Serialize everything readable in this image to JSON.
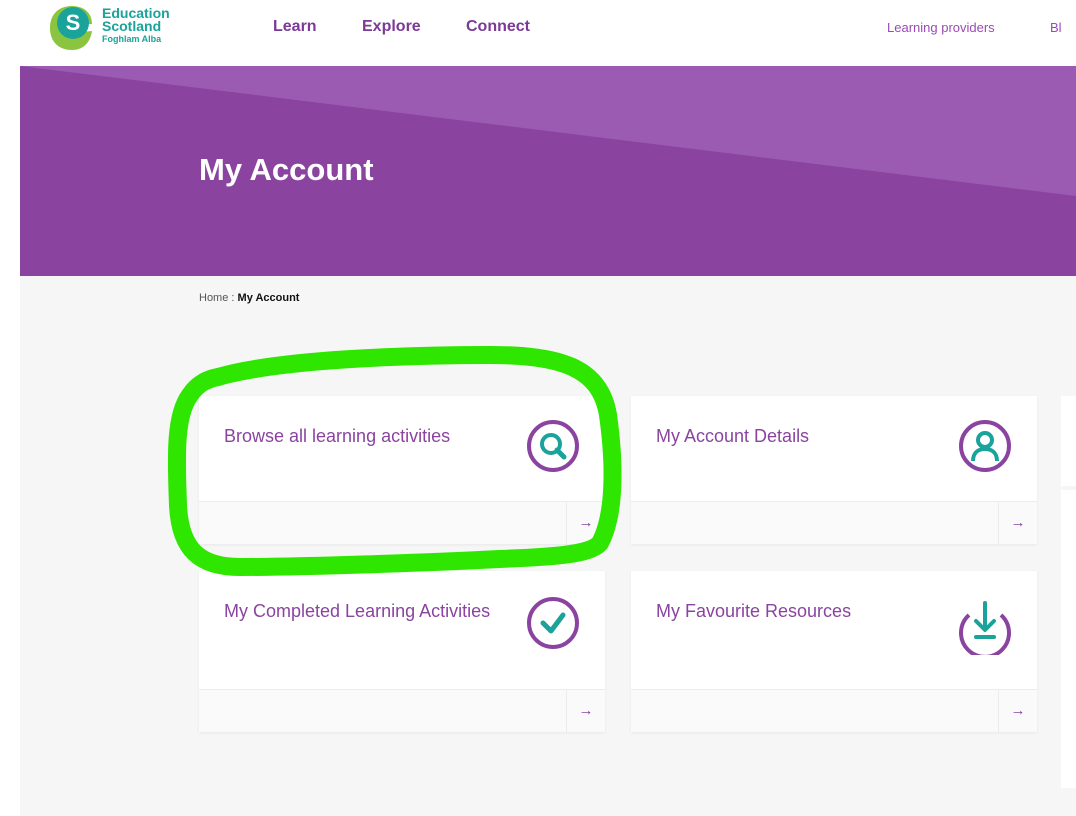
{
  "header": {
    "logo": {
      "line1": "Education",
      "line2": "Scotland",
      "line3": "Foghlam Alba"
    },
    "nav": [
      "Learn",
      "Explore",
      "Connect"
    ],
    "utility": [
      "Learning providers",
      "Bl"
    ]
  },
  "hero": {
    "title": "My Account"
  },
  "breadcrumb": {
    "home": "Home",
    "separator": ":",
    "current": "My Account"
  },
  "cards": [
    {
      "label": "Browse all learning activities",
      "icon": "search-icon",
      "arrow": "→"
    },
    {
      "label": "My Account Details",
      "icon": "user-icon",
      "arrow": "→"
    },
    {
      "label": "My Completed Learning Activities",
      "icon": "check-icon",
      "arrow": "→"
    },
    {
      "label": "My Favourite Resources",
      "icon": "download-icon",
      "arrow": "→"
    }
  ],
  "colors": {
    "brand_purple": "#8a44a0",
    "teal": "#1aa39a",
    "highlight_green": "#2ee600"
  }
}
